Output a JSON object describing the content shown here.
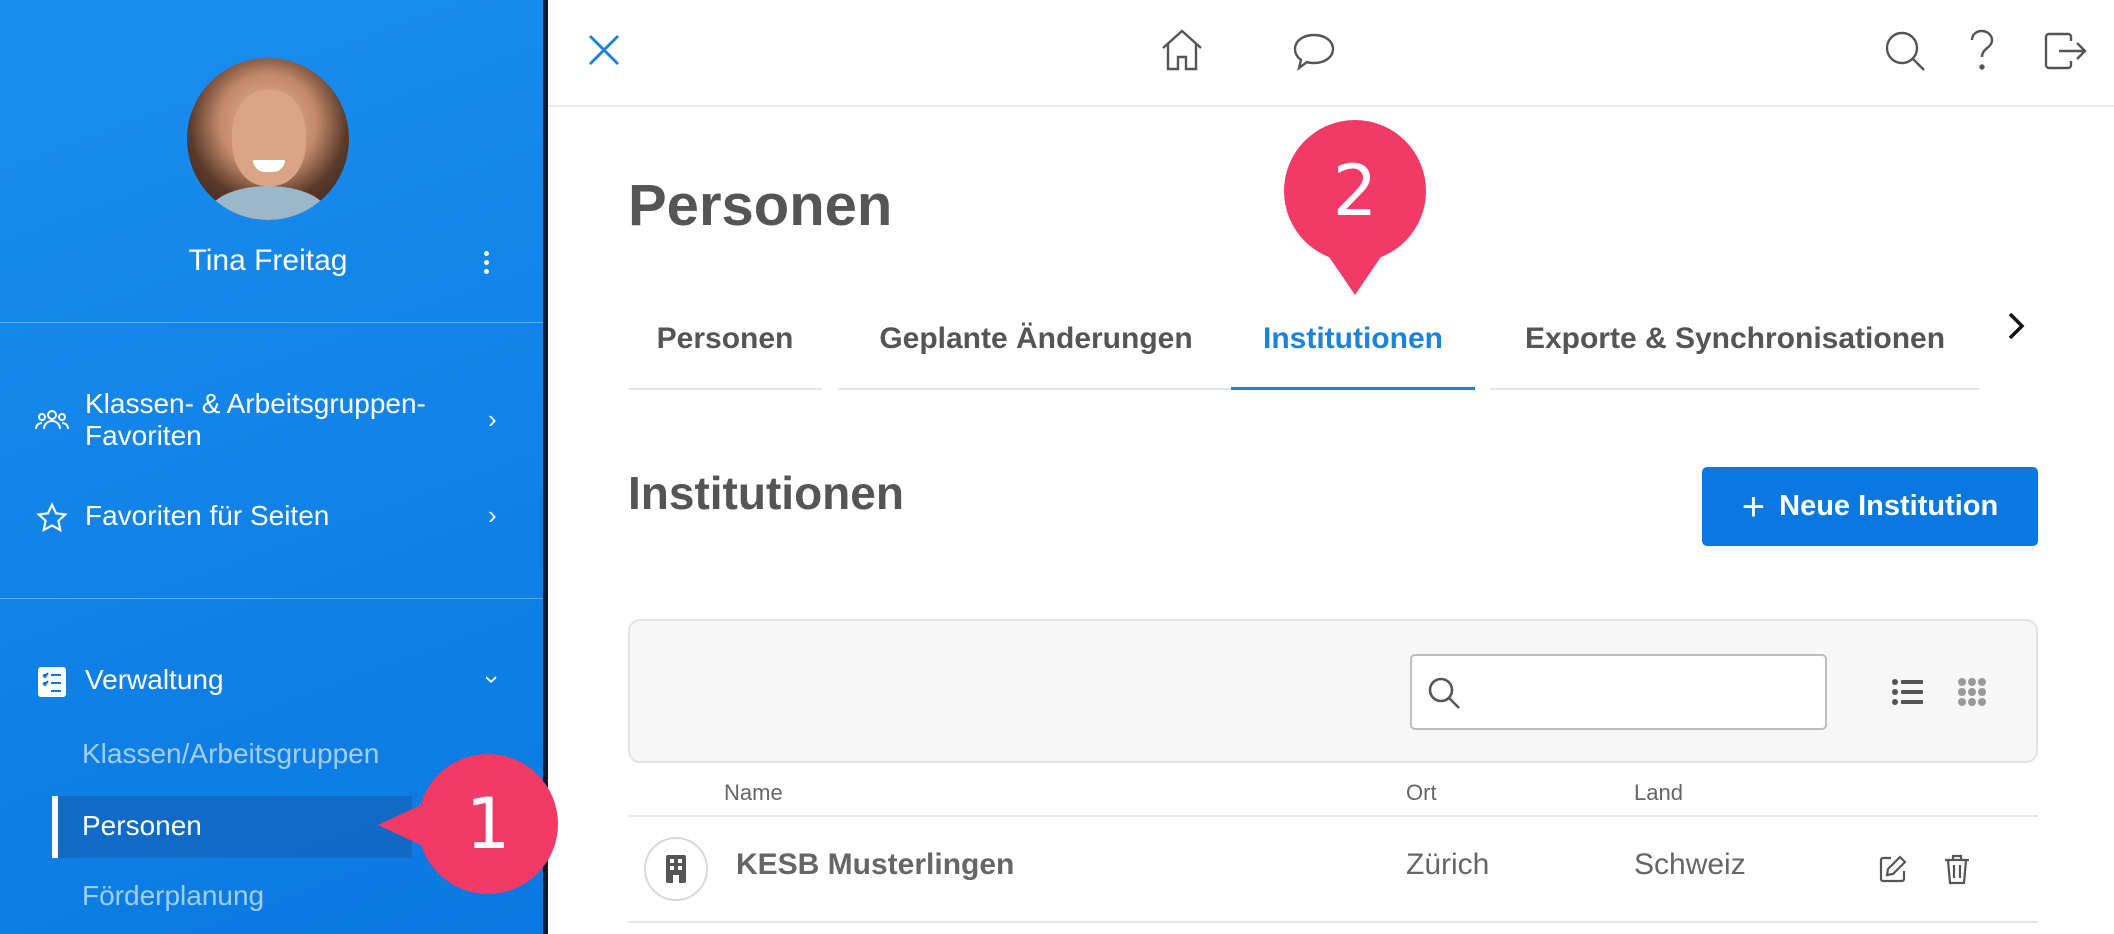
{
  "sidebar": {
    "user_name": "Tina Freitag",
    "items": [
      {
        "label": "Klassen- & Arbeitsgruppen-\nFavoriten",
        "icon": "group-icon"
      },
      {
        "label": "Favoriten für Seiten",
        "icon": "star-icon"
      },
      {
        "label": "Verwaltung",
        "icon": "checklist-icon"
      }
    ],
    "sub_items": [
      {
        "label": "Klassen/Arbeitsgruppen"
      },
      {
        "label": "Personen"
      },
      {
        "label": "Förderplanung"
      }
    ]
  },
  "topbar": {
    "icons": [
      "close-icon",
      "home-icon",
      "chat-icon",
      "search-icon",
      "help-icon",
      "logout-icon"
    ]
  },
  "main": {
    "page_title": "Personen",
    "tabs": [
      {
        "label": "Personen"
      },
      {
        "label": "Geplante Änderungen"
      },
      {
        "label": "Institutionen"
      },
      {
        "label": "Exporte & Synchronisationen"
      }
    ],
    "active_tab": "Institutionen",
    "section_title": "Institutionen",
    "new_button": "Neue Institution",
    "search": {
      "value": "",
      "placeholder": ""
    },
    "table": {
      "columns": [
        "Name",
        "Ort",
        "Land"
      ],
      "rows": [
        {
          "name": "KESB Musterlingen",
          "ort": "Zürich",
          "land": "Schweiz"
        }
      ]
    }
  },
  "markers": {
    "step1": "1",
    "step2": "2"
  },
  "colors": {
    "accent": "#0a78e0",
    "marker": "#f23a66",
    "sidebar": "#1a8ef0"
  }
}
